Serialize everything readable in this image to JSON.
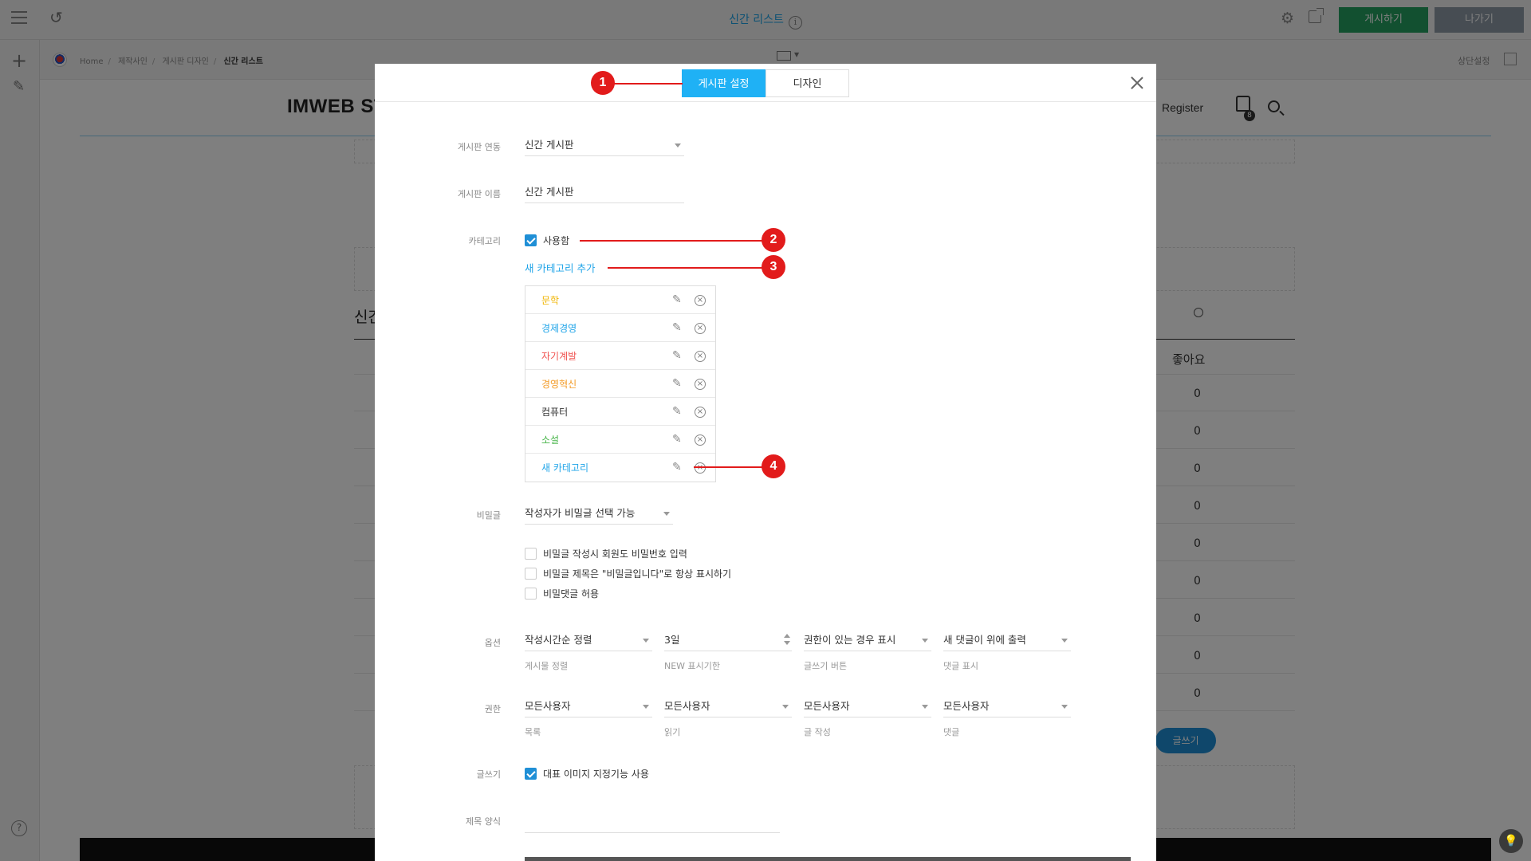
{
  "editor": {
    "page_title": "신간 리스트",
    "publish_label": "게시하기",
    "exit_label": "나가기",
    "top_settings_label": "상단설정",
    "breadcrumb": [
      "Home",
      "제작사인",
      "게시판 디자인",
      "신간 리스트"
    ]
  },
  "site": {
    "logo": "IMWEB STA",
    "register": "Register",
    "cart_count": "8",
    "board_title": "신간",
    "likes_header": "좋아요",
    "like_values": [
      "0",
      "0",
      "0",
      "0",
      "0",
      "0",
      "0",
      "0",
      "0"
    ],
    "write_button": "글쓰기"
  },
  "modal": {
    "tabs": [
      {
        "label": "게시판 설정",
        "active": true
      },
      {
        "label": "디자인",
        "active": false
      }
    ],
    "board_link": {
      "label": "게시판 연동",
      "value": "신간 게시판"
    },
    "board_name": {
      "label": "게시판 이름",
      "value": "신간 게시판"
    },
    "category": {
      "label": "카테고리",
      "use_label": "사용함",
      "use_checked": true,
      "add_label": "새 카테고리 추가",
      "items": [
        {
          "name": "문학",
          "color": "#f0b400"
        },
        {
          "name": "경제경영",
          "color": "#1fa4e8"
        },
        {
          "name": "자기계발",
          "color": "#f0524f"
        },
        {
          "name": "경영혁신",
          "color": "#f39a24"
        },
        {
          "name": "컴퓨터",
          "color": "#333333"
        },
        {
          "name": "소설",
          "color": "#48b54a"
        },
        {
          "name": "새 카테고리",
          "color": "#1fa4e8"
        }
      ]
    },
    "secret": {
      "label": "비밀글",
      "value": "작성자가 비밀글 선택 가능",
      "options": [
        {
          "label": "비밀글 작성시 회원도 비밀번호 입력",
          "checked": false
        },
        {
          "label": "비밀글 제목은 \"비밀글입니다\"로 항상 표시하기",
          "checked": false
        },
        {
          "label": "비밀댓글 허용",
          "checked": false
        }
      ]
    },
    "options": {
      "label": "옵션",
      "fields": [
        {
          "value": "작성시간순 정렬",
          "caption": "게시물 정렬"
        },
        {
          "value": "3일",
          "caption": "NEW 표시기한"
        },
        {
          "value": "권한이 있는 경우 표시",
          "caption": "글쓰기 버튼"
        },
        {
          "value": "새 댓글이 위에 출력",
          "caption": "댓글 표시"
        }
      ]
    },
    "permission": {
      "label": "권한",
      "fields": [
        {
          "value": "모든사용자",
          "caption": "목록"
        },
        {
          "value": "모든사용자",
          "caption": "읽기"
        },
        {
          "value": "모든사용자",
          "caption": "글 작성"
        },
        {
          "value": "모든사용자",
          "caption": "댓글"
        }
      ]
    },
    "writing": {
      "label": "글쓰기",
      "option_label": "대표 이미지 지정기능 사용",
      "checked": true
    },
    "title_format": {
      "label": "제목 양식"
    }
  },
  "callouts": [
    "1",
    "2",
    "3",
    "4"
  ],
  "colors": {
    "accent": "#1fb1f5",
    "publish": "#25a161",
    "exit": "#8e9aa6",
    "callout": "#e21b1b"
  }
}
